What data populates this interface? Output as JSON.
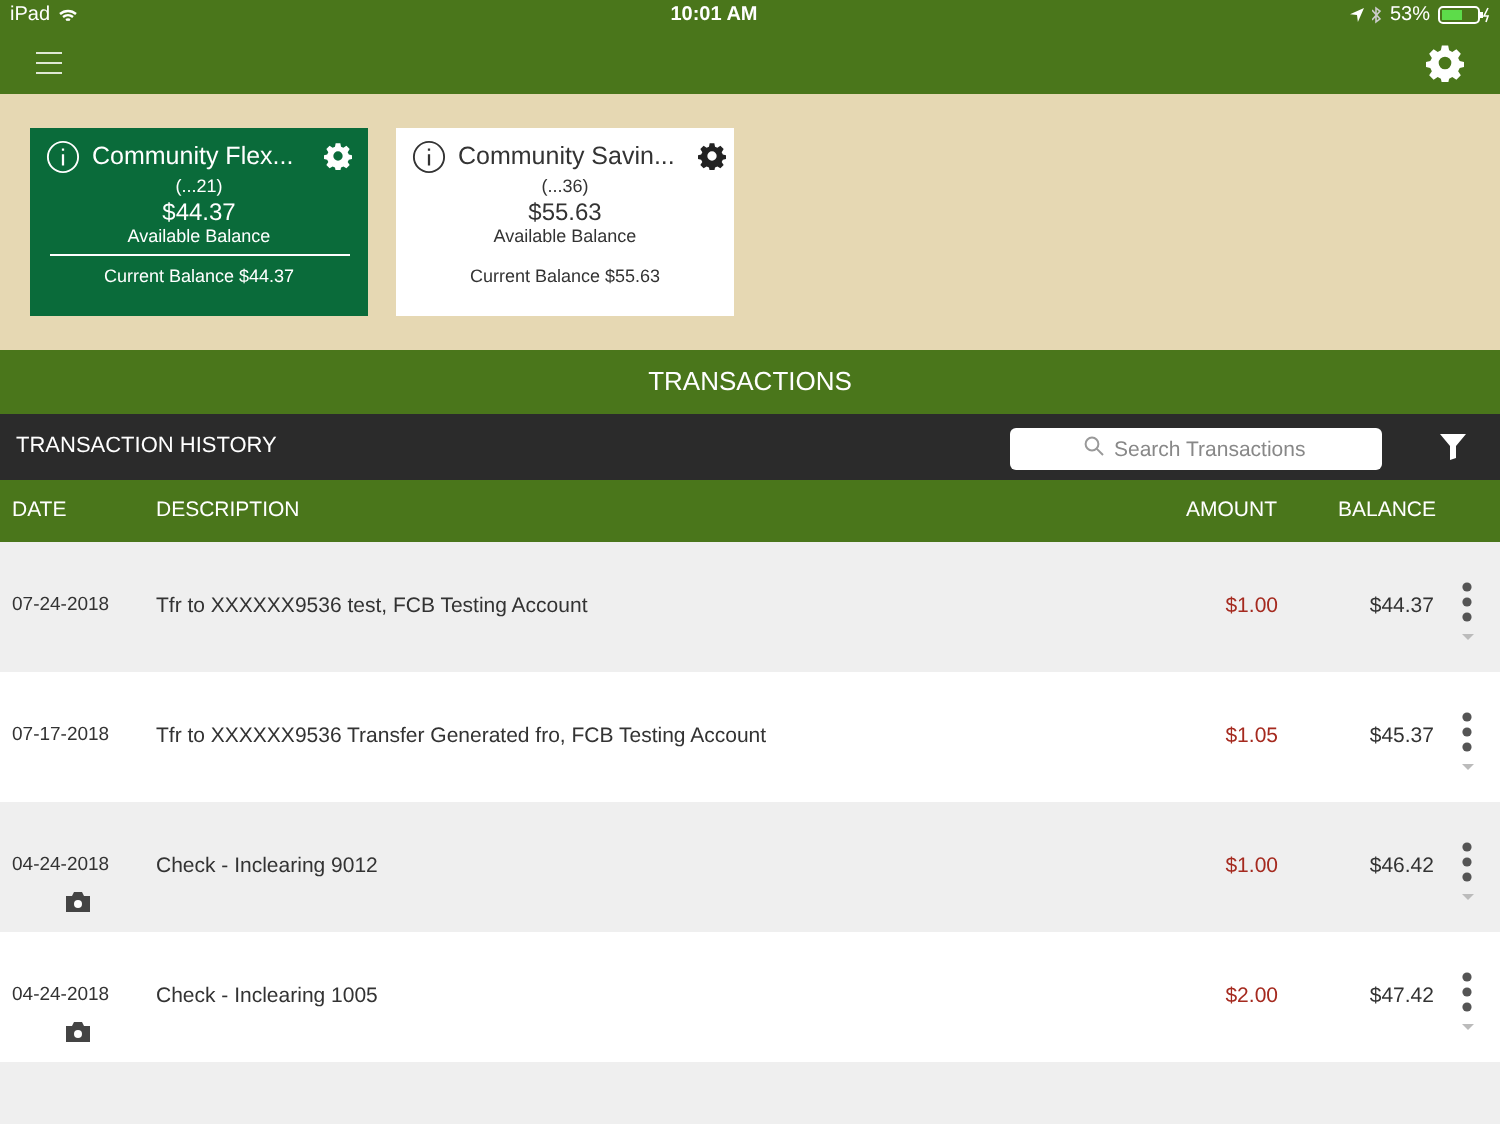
{
  "status_bar": {
    "device": "iPad",
    "time": "10:01 AM",
    "battery": "53%"
  },
  "accounts": [
    {
      "name": "Community  Flex...",
      "number": "(...21)",
      "balance": "$44.37",
      "balance_label": "Available Balance",
      "current": "Current Balance $44.37",
      "selected": true
    },
    {
      "name": "Community Savin...",
      "number": "(...36)",
      "balance": "$55.63",
      "balance_label": "Available Balance",
      "current": "Current Balance $55.63",
      "selected": false
    }
  ],
  "section_title": "TRANSACTIONS",
  "history": {
    "title": "TRANSACTION HISTORY",
    "search": {
      "placeholder": "Search Transactions"
    }
  },
  "table": {
    "columns": [
      "DATE",
      "DESCRIPTION",
      "AMOUNT",
      "BALANCE"
    ],
    "rows": [
      {
        "date": "07-24-2018",
        "description": "Tfr to XXXXXX9536 test, FCB Testing Account",
        "amount": "$1.00",
        "balance": "$44.37",
        "kind": "debit",
        "has_image": false
      },
      {
        "date": "07-17-2018",
        "description": "Tfr to XXXXXX9536 Transfer Generated fro, FCB Testing Account",
        "amount": "$1.05",
        "balance": "$45.37",
        "kind": "debit",
        "has_image": false
      },
      {
        "date": "04-24-2018",
        "description": "Check - Inclearing 9012",
        "amount": "$1.00",
        "balance": "$46.42",
        "kind": "debit",
        "has_image": true
      },
      {
        "date": "04-24-2018",
        "description": "Check - Inclearing 1005",
        "amount": "$2.00",
        "balance": "$47.42",
        "kind": "debit",
        "has_image": true
      }
    ]
  }
}
